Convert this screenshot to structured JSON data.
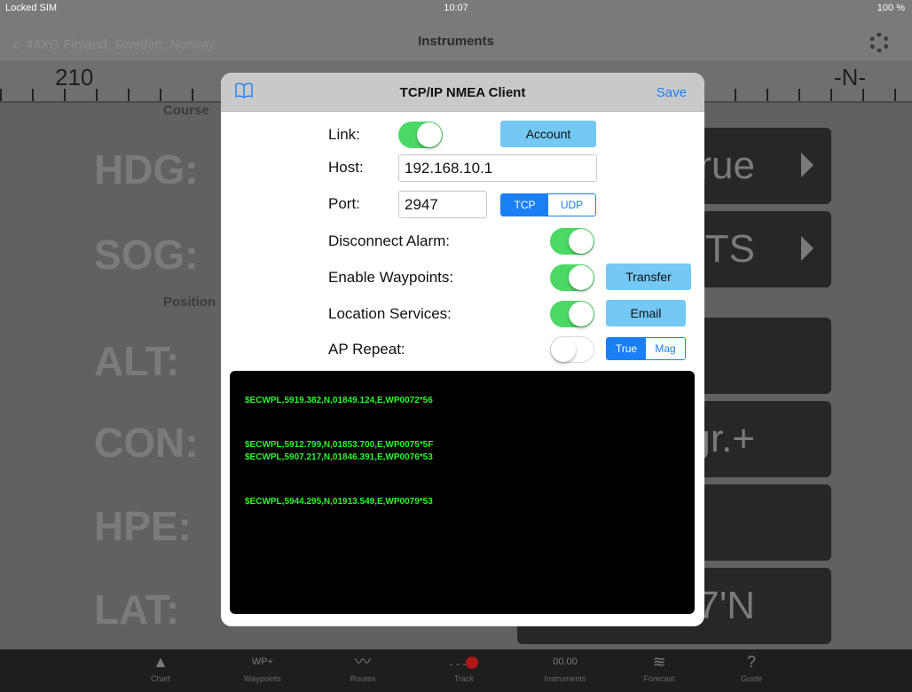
{
  "status_bar": {
    "carrier": "Locked SIM",
    "time": "10:07",
    "battery": "100 %"
  },
  "nav": {
    "back_label": "44XG Finland, Sweden, Norway",
    "title": "Instruments",
    "settings_icon": "gear-icon"
  },
  "compass": {
    "labels": [
      "210",
      "-N-"
    ]
  },
  "background": {
    "sections": [
      "Course",
      "Position"
    ],
    "instrument_labels": [
      "HDG:",
      "SOG:",
      "ALT:",
      "CON:",
      "HPE:",
      "LAT:"
    ],
    "right_values": [
      "rue",
      "TS",
      "gr.+",
      "37'N"
    ]
  },
  "modal": {
    "title": "TCP/IP NMEA Client",
    "save_label": "Save",
    "link_label": "Link:",
    "account_label": "Account",
    "host_label": "Host:",
    "host_value": "192.168.10.1",
    "port_label": "Port:",
    "port_value": "2947",
    "protocol_options": [
      "TCP",
      "UDP"
    ],
    "protocol_selected": "TCP",
    "disconnect_alarm_label": "Disconnect Alarm:",
    "enable_waypoints_label": "Enable Waypoints:",
    "transfer_label": "Transfer",
    "location_services_label": "Location Services:",
    "email_label": "Email",
    "ap_repeat_label": "AP Repeat:",
    "heading_options": [
      "True",
      "Mag"
    ],
    "heading_selected": "True",
    "toggles": {
      "link": true,
      "disconnect_alarm": true,
      "enable_waypoints": true,
      "location_services": true,
      "ap_repeat": false
    },
    "console_lines": [
      "$ECWPL,5919.382,N,01849.124,E,WP0072*56",
      "$ECWPL,5912.799,N,01853.700,E,WP0075*5F",
      "$ECWPL,5907.217,N,01846.391,E,WP0076*53",
      "$ECWPL,5944.295,N,01913.549,E,WP0079*53"
    ],
    "console_color": "#2cf52c",
    "accent_color": "#1a7ff5",
    "toggle_on_color": "#4cd864"
  },
  "tab_bar": {
    "tabs": [
      {
        "label": "Chart",
        "icon": "WP+"
      },
      {
        "label": "Waypoints",
        "icon": "WP+"
      },
      {
        "label": "Routes",
        "icon": ""
      },
      {
        "label": "Track",
        "icon": ""
      },
      {
        "label": "Instruments",
        "icon": "00.00"
      },
      {
        "label": "Forecast",
        "icon": ""
      },
      {
        "label": "Guide",
        "icon": "?"
      }
    ]
  }
}
